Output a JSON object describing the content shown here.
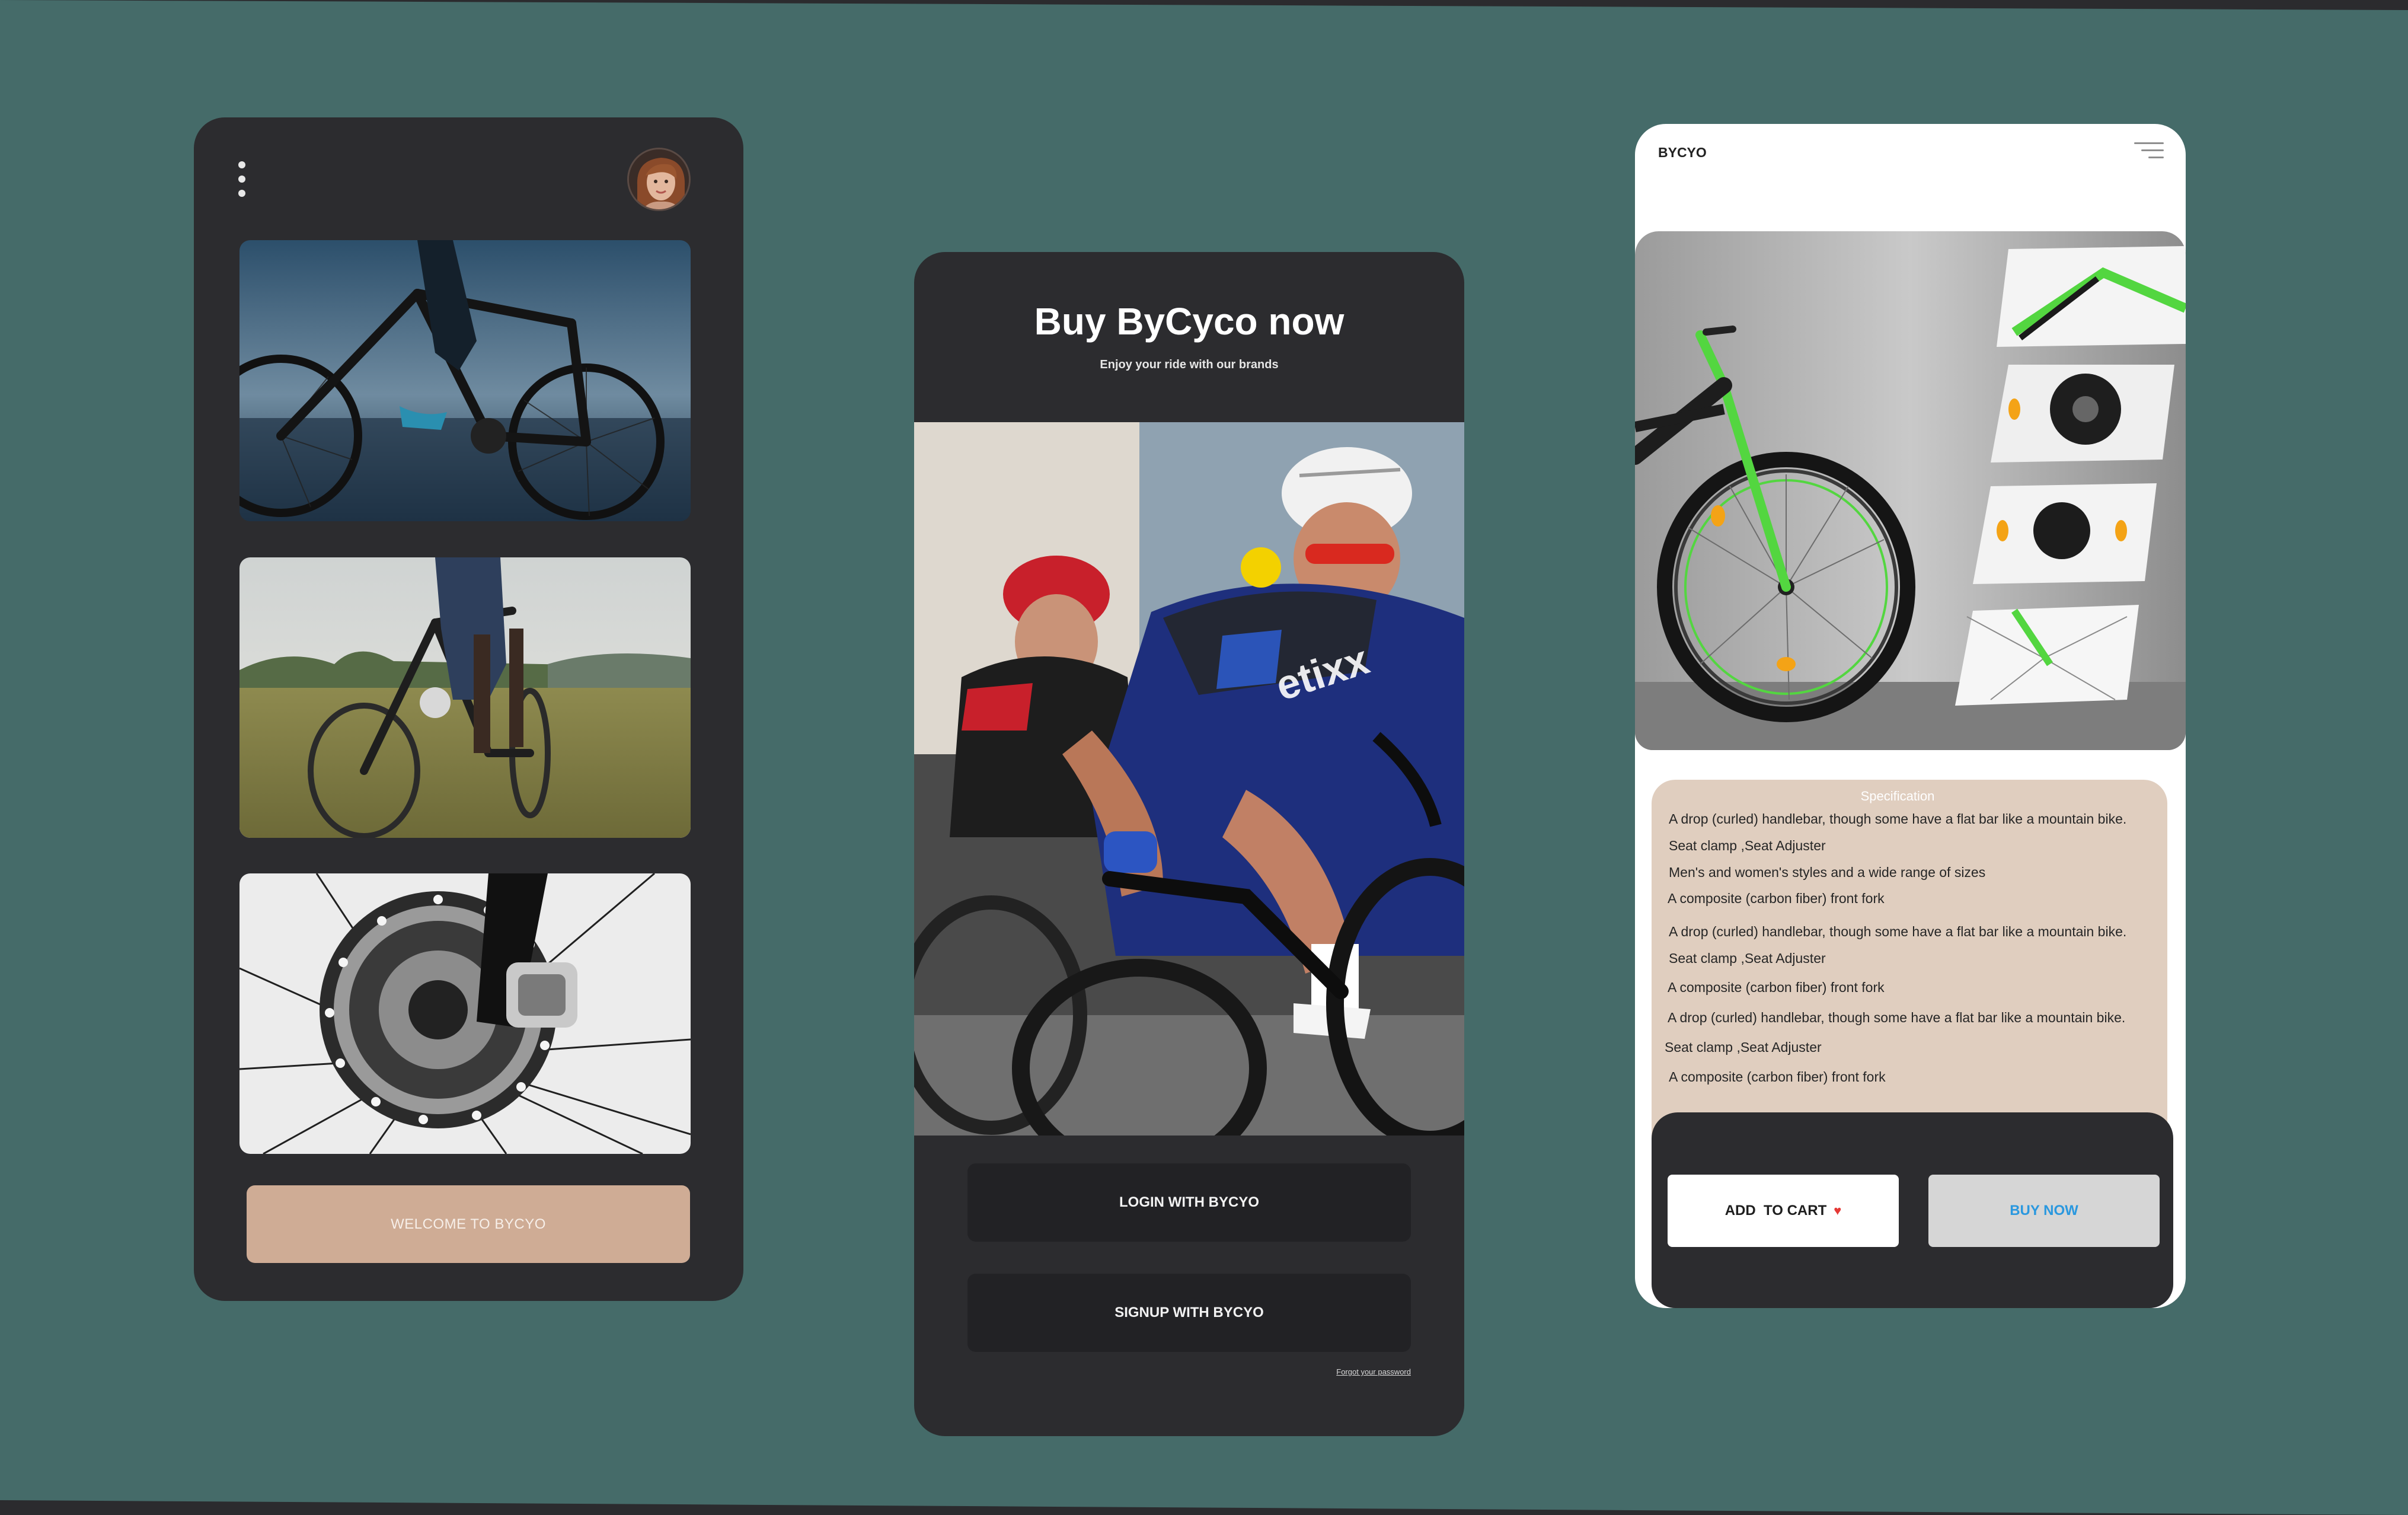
{
  "screen1": {
    "menu_icon": "vertical-ellipsis",
    "avatar_icon": "user-avatar",
    "photos": [
      "mountain-bike-rider-photo",
      "bike-on-grass-photo",
      "disc-brake-photo"
    ],
    "welcome_button": "WELCOME TO BYCYO"
  },
  "screen2": {
    "title": "Buy ByCyco now",
    "subtitle": "Enjoy your ride with our brands",
    "hero_image": "road-cyclists-racing-photo",
    "login_button": "LOGIN WITH BYCYO",
    "signup_button": "SIGNUP WITH BYCYO",
    "forgot_link": "Forgot your password"
  },
  "screen3": {
    "brand": "BYCYO",
    "menu_icon": "hamburger",
    "product_image": "black-green-bicycle-with-detail-shots",
    "spec_title": "Specification",
    "spec_lines": [
      "A drop (curled) handlebar, though some have a flat bar like a mountain bike.",
      "Seat clamp ,Seat Adjuster",
      "Men's and women's styles and a wide range of sizes",
      "A composite (carbon fiber) front fork",
      "A drop (curled) handlebar, though some have a flat bar like a mountain bike.",
      "Seat clamp ,Seat Adjuster",
      "A composite (carbon fiber) front fork",
      "A drop (curled) handlebar, though some have a flat bar like a mountain bike.",
      "Seat clamp ,Seat Adjuster",
      "A composite (carbon fiber) front fork"
    ],
    "add_to_cart": "ADD  TO CART",
    "buy_now": "BUY NOW",
    "colors": {
      "accent_blue": "#2a98df",
      "heart_red": "#e53935",
      "spec_bg": "#e0cebf"
    }
  },
  "colors": {
    "background": "#456b69",
    "card_dark": "#2c2c2f",
    "welcome_button": "#cfac95"
  }
}
